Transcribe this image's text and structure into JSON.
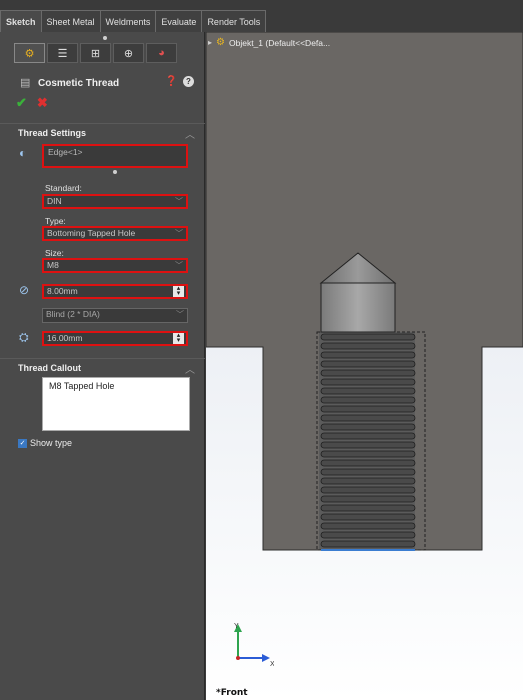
{
  "tabs": [
    "Sketch",
    "Sheet Metal",
    "Weldments",
    "Evaluate",
    "Render Tools"
  ],
  "panel": {
    "title": "Cosmetic Thread",
    "sections": {
      "thread_settings": "Thread Settings",
      "thread_callout": "Thread Callout"
    },
    "edge_value": "Edge<1>",
    "standard_label": "Standard:",
    "standard_value": "DIN",
    "type_label": "Type:",
    "type_value": "Bottoming Tapped Hole",
    "size_label": "Size:",
    "size_value": "M8",
    "diameter_value": "8.00mm",
    "end_condition_value": "Blind (2 * DIA)",
    "depth_value": "16.00mm",
    "callout_text": "M8 Tapped Hole",
    "show_type_label": "Show type",
    "show_type_checked": true
  },
  "viewport": {
    "tree_item": "Objekt_1  (Default<<Defa...",
    "view_label": "*Front",
    "axis_x": "X",
    "axis_y": "Y"
  },
  "colors": {
    "required_field_border": "#dd1111",
    "ok": "#3ab13a",
    "cancel": "#e03030",
    "part_gray": "#6a6764"
  },
  "icons": [
    "thread-feature-icon",
    "ok-check-icon",
    "cancel-x-icon",
    "help-icon",
    "edge-select-icon",
    "diameter-icon",
    "depth-icon"
  ]
}
